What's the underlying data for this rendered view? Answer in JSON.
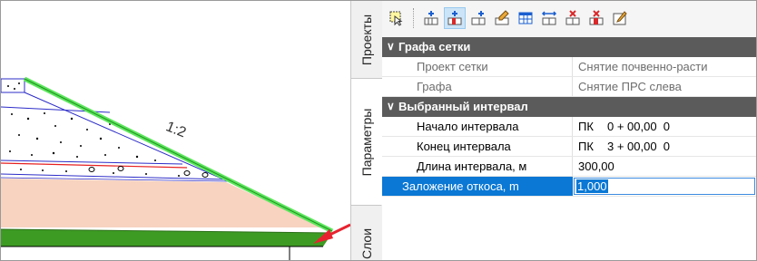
{
  "drawing": {
    "slope_label": "1:2",
    "colors": {
      "soil_fill": "#f7d3c0",
      "topsoil_band": "#3d9b23",
      "slope_line": "#5ce65c",
      "pointer_arrow": "#e8232f",
      "layer_line_blue": "#2c2cc8",
      "layer_line_red": "#e62020"
    }
  },
  "side_tabs": [
    {
      "label": "Проекты",
      "active": false
    },
    {
      "label": "Параметры",
      "active": true
    },
    {
      "label": "Слои",
      "active": false
    }
  ],
  "toolbar": {
    "icons": [
      "select-element-icon",
      "add-interval-icon",
      "add-interval-active-icon",
      "add-interval-right-icon",
      "edit-interval-icon",
      "table-icon",
      "split-interval-icon",
      "delete-interval-icon",
      "delete-all-intervals-icon",
      "interval-properties-icon"
    ],
    "active_index": 2
  },
  "property_grid": {
    "category_grid": {
      "label": "Графа сетки",
      "rows": [
        {
          "name": "Проект сетки",
          "value": "Снятие почвенно-расти"
        },
        {
          "name": "Графа",
          "value": "Снятие ПРС слева"
        }
      ]
    },
    "category_interval": {
      "label": "Выбранный интервал",
      "rows": [
        {
          "name": "Начало интервала",
          "pk": "ПК",
          "value": "0 + 00,00  0"
        },
        {
          "name": "Конец интервала",
          "pk": "ПК",
          "value": "3 + 00,00  0"
        },
        {
          "name": "Длина интервала, м",
          "value": "300,00"
        },
        {
          "name": "Заложение откоса, m",
          "value": "1,000"
        }
      ]
    }
  },
  "colors": {
    "category_bg": "#5b5b5b",
    "selection_bg": "#0a78d4",
    "toolbar_bg": "#f5f5f5"
  }
}
